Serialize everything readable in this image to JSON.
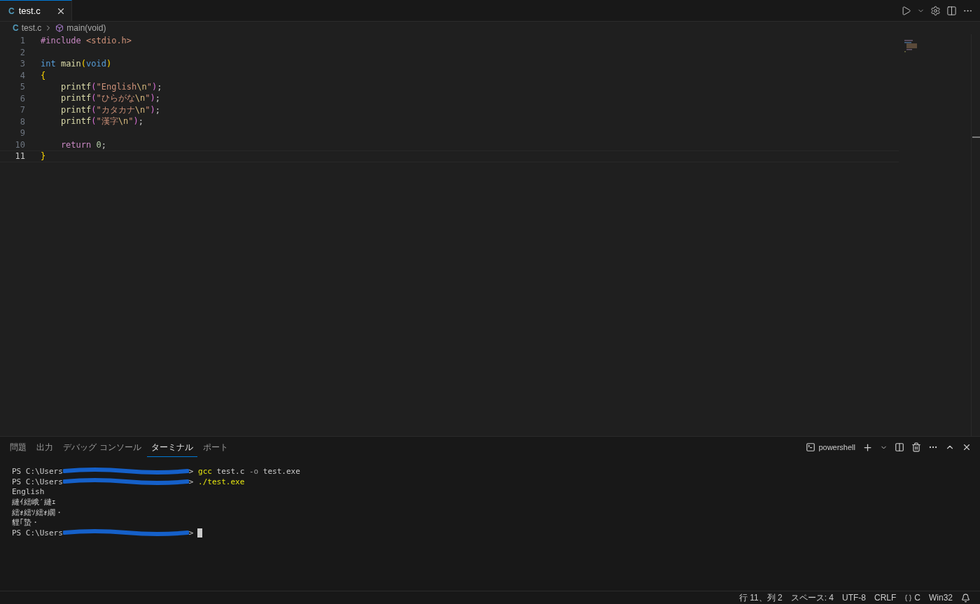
{
  "tabs": [
    {
      "label": "test.c",
      "language": "C",
      "selected": true
    }
  ],
  "breadcrumb": {
    "language": "C",
    "file": "test.c",
    "symbol": "main(void)"
  },
  "code_lines": [
    {
      "number": "1",
      "selected": false,
      "tokens": [
        {
          "kind": "directive",
          "text": "#include "
        },
        {
          "kind": "header",
          "text": "<stdio.h>"
        }
      ]
    },
    {
      "number": "2",
      "selected": false
    },
    {
      "number": "3",
      "selected": false,
      "tokens": [
        {
          "kind": "keyword",
          "text": "int "
        },
        {
          "kind": "function",
          "text": "main"
        },
        {
          "kind": "bracket",
          "text": "("
        },
        {
          "kind": "keyword",
          "text": "void"
        },
        {
          "kind": "bracket",
          "text": ")"
        }
      ]
    },
    {
      "number": "4",
      "selected": false,
      "tokens": [
        {
          "kind": "bracket",
          "text": "{"
        }
      ]
    },
    {
      "number": "5",
      "selected": false,
      "tokens": [
        {
          "kind": "function",
          "text": "    printf"
        },
        {
          "kind": "bracket2",
          "text": "("
        },
        {
          "kind": "string",
          "text": "\"English"
        },
        {
          "kind": "escape",
          "text": "\\n"
        },
        {
          "kind": "string",
          "text": "\""
        },
        {
          "kind": "bracket2",
          "text": ")"
        },
        {
          "kind": "plain",
          "text": ";"
        }
      ]
    },
    {
      "number": "6",
      "selected": false,
      "tokens": [
        {
          "kind": "function",
          "text": "    printf"
        },
        {
          "kind": "bracket2",
          "text": "("
        },
        {
          "kind": "string",
          "text": "\"ひらがな"
        },
        {
          "kind": "escape",
          "text": "\\n"
        },
        {
          "kind": "string",
          "text": "\""
        },
        {
          "kind": "bracket2",
          "text": ")"
        },
        {
          "kind": "plain",
          "text": ";"
        }
      ]
    },
    {
      "number": "7",
      "selected": false,
      "tokens": [
        {
          "kind": "function",
          "text": "    printf"
        },
        {
          "kind": "bracket2",
          "text": "("
        },
        {
          "kind": "string",
          "text": "\"カタカナ"
        },
        {
          "kind": "escape",
          "text": "\\n"
        },
        {
          "kind": "string",
          "text": "\""
        },
        {
          "kind": "bracket2",
          "text": ")"
        },
        {
          "kind": "plain",
          "text": ";"
        }
      ]
    },
    {
      "number": "8",
      "selected": false,
      "tokens": [
        {
          "kind": "function",
          "text": "    printf"
        },
        {
          "kind": "bracket2",
          "text": "("
        },
        {
          "kind": "string",
          "text": "\"漢字"
        },
        {
          "kind": "escape",
          "text": "\\n"
        },
        {
          "kind": "string",
          "text": "\""
        },
        {
          "kind": "bracket2",
          "text": ")"
        },
        {
          "kind": "plain",
          "text": ";"
        }
      ]
    },
    {
      "number": "9",
      "selected": false
    },
    {
      "number": "10",
      "selected": false,
      "tokens": [
        {
          "kind": "control",
          "text": "    return "
        },
        {
          "kind": "number",
          "text": "0"
        },
        {
          "kind": "plain",
          "text": ";"
        }
      ]
    },
    {
      "number": "11",
      "selected": true,
      "tokens": [
        {
          "kind": "bracket",
          "text": "}"
        }
      ]
    }
  ],
  "panel": {
    "tabs": [
      {
        "label": "問題",
        "selected": false
      },
      {
        "label": "出力",
        "selected": false
      },
      {
        "label": "デバッグ コンソール",
        "selected": false
      },
      {
        "label": "ターミナル",
        "selected": true
      },
      {
        "label": "ポート",
        "selected": false
      }
    ],
    "shell": "powershell",
    "terminal_lines": [
      {
        "kind": "prompt",
        "prompt": "PS C:\\Users",
        "end": ">",
        "command": "gcc",
        "args": "test.c",
        "flag": "-o",
        "rest": "test.exe"
      },
      {
        "kind": "prompt",
        "prompt": "PS C:\\Users",
        "end": ">",
        "command": "./test.exe"
      },
      {
        "kind": "output",
        "text": "English"
      },
      {
        "kind": "output",
        "text": "縺ｲ繧峨′縺ｪ"
      },
      {
        "kind": "output",
        "text": "繧ｫ繧ｿ繧ｫ繝・"
      },
      {
        "kind": "output",
        "text": "貍｢蟄・"
      },
      {
        "kind": "prompt",
        "prompt": "PS C:\\Users",
        "end": ">",
        "cursor": true
      }
    ]
  },
  "status_bar": {
    "items": [
      "行 11、列 2",
      "スペース: 4",
      "UTF-8",
      "CRLF",
      "C",
      "Win32"
    ]
  }
}
